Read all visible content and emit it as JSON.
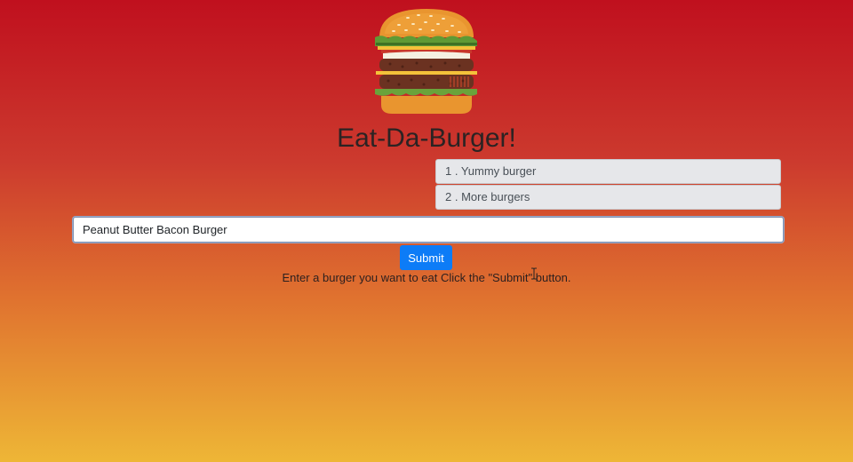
{
  "page": {
    "title": "Eat-Da-Burger!",
    "logo_icon": "burger-icon"
  },
  "burgers": [
    {
      "label": "1 . Yummy burger"
    },
    {
      "label": "2 . More burgers"
    }
  ],
  "form": {
    "input_value": "Peanut Butter Bacon Burger",
    "submit_label": "Submit",
    "instructions": "Enter a burger you want to eat Click the \"Submit\" button."
  },
  "colors": {
    "gradient_top": "#c0101e",
    "gradient_bottom": "#eeb636",
    "submit_button": "#0d7cf7",
    "list_item_bg": "#e6e7ea"
  }
}
